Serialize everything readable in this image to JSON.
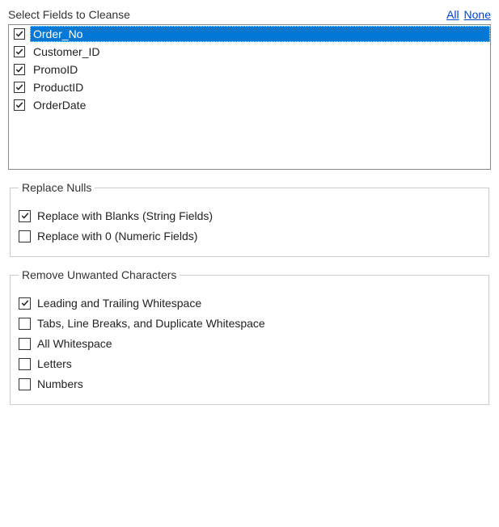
{
  "header": {
    "title": "Select Fields to Cleanse",
    "link_all": "All",
    "link_none": "None"
  },
  "fields": [
    {
      "name": "Order_No",
      "checked": true,
      "highlighted": true
    },
    {
      "name": "Customer_ID",
      "checked": true,
      "highlighted": false
    },
    {
      "name": "PromoID",
      "checked": true,
      "highlighted": false
    },
    {
      "name": "ProductID",
      "checked": true,
      "highlighted": false
    },
    {
      "name": "OrderDate",
      "checked": true,
      "highlighted": false
    }
  ],
  "replace_nulls": {
    "legend": "Replace Nulls",
    "options": [
      {
        "label": "Replace with Blanks (String Fields)",
        "checked": true
      },
      {
        "label": "Replace with 0 (Numeric Fields)",
        "checked": false
      }
    ]
  },
  "remove_chars": {
    "legend": "Remove Unwanted Characters",
    "options": [
      {
        "label": "Leading and Trailing Whitespace",
        "checked": true
      },
      {
        "label": "Tabs, Line Breaks, and Duplicate Whitespace",
        "checked": false
      },
      {
        "label": "All Whitespace",
        "checked": false
      },
      {
        "label": "Letters",
        "checked": false
      },
      {
        "label": "Numbers",
        "checked": false
      }
    ]
  }
}
